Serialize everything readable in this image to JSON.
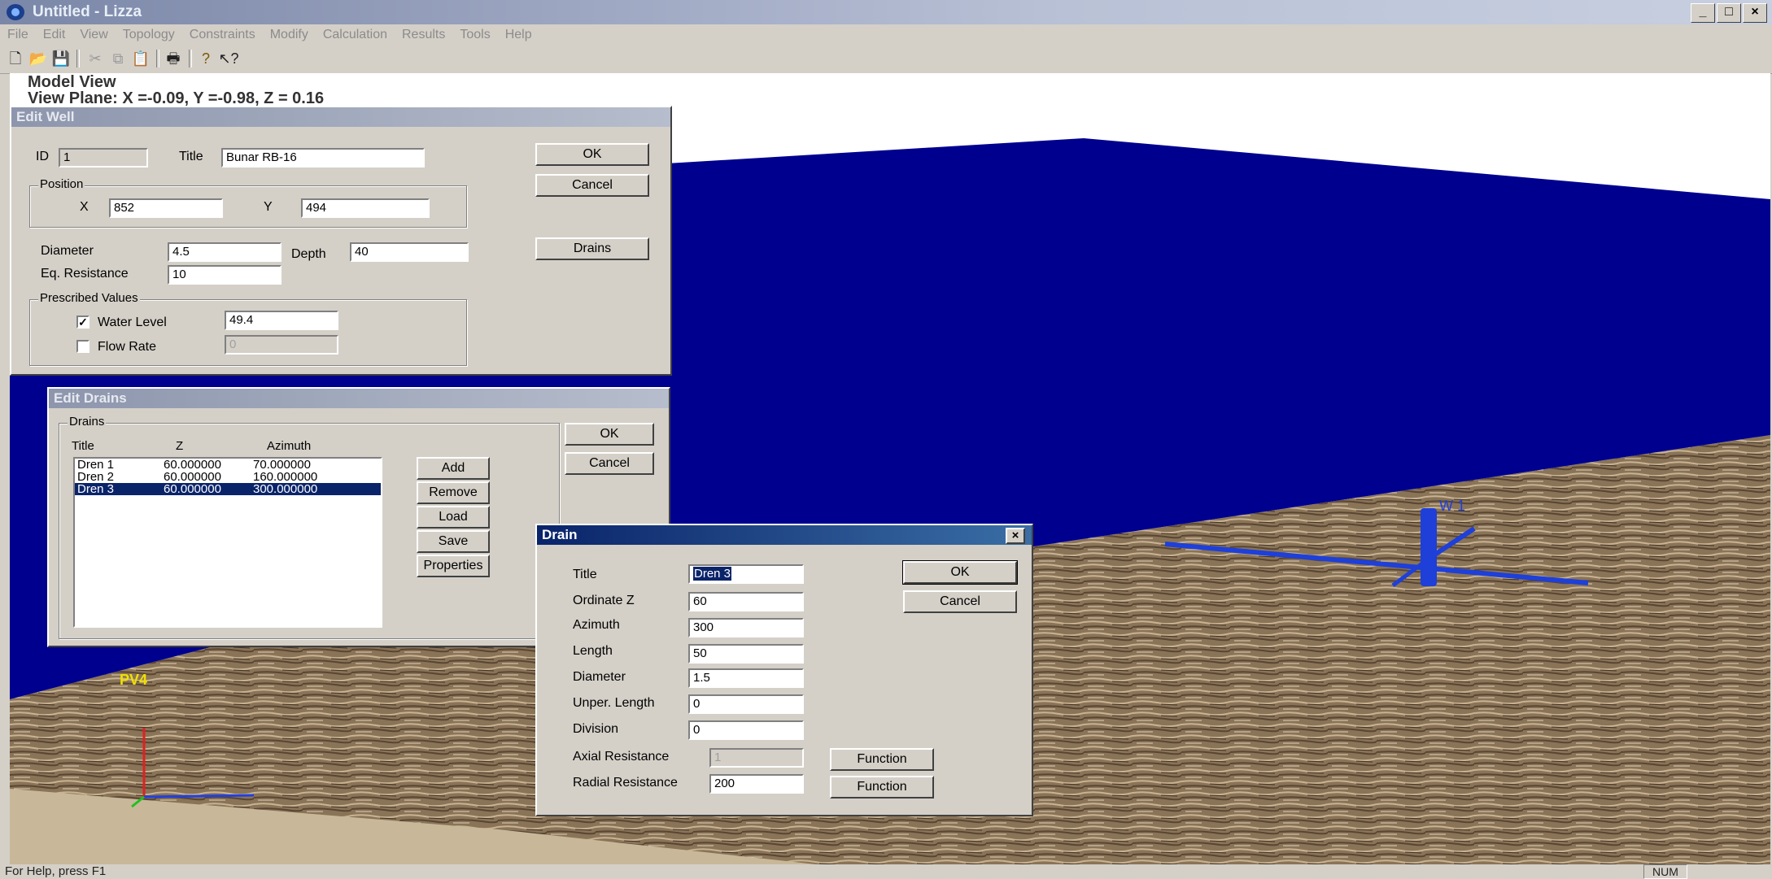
{
  "window": {
    "title": "Untitled - Lizza",
    "min": "_",
    "max": "□",
    "close": "×"
  },
  "menu": [
    "File",
    "Edit",
    "View",
    "Topology",
    "Constraints",
    "Modify",
    "Calculation",
    "Results",
    "Tools",
    "Help"
  ],
  "model_view": {
    "title": "Model View",
    "plane": "View Plane: X =-0.09,  Y =-0.98,  Z = 0.16",
    "well_label_w1": "W 1",
    "well_label_pv4": "PV4"
  },
  "edit_well": {
    "title": "Edit Well",
    "id_label": "ID",
    "id_value": "1",
    "title_label": "Title",
    "title_value": "Bunar RB-16",
    "position_label": "Position",
    "x_label": "X",
    "x_value": "852",
    "y_label": "Y",
    "y_value": "494",
    "diameter_label": "Diameter",
    "diameter_value": "4.5",
    "depth_label": "Depth",
    "depth_value": "40",
    "eq_res_label": "Eq. Resistance",
    "eq_res_value": "10",
    "prescribed_label": "Prescribed Values",
    "water_level_label": "Water Level",
    "water_level_value": "49.4",
    "water_level_checked": "✓",
    "flow_rate_label": "Flow Rate",
    "flow_rate_value": "0",
    "ok": "OK",
    "cancel": "Cancel",
    "drains": "Drains"
  },
  "edit_drains": {
    "title": "Edit Drains",
    "group_label": "Drains",
    "headers": [
      "Title",
      "Z",
      "Azimuth"
    ],
    "rows": [
      {
        "title": "Dren 1",
        "z": "60.000000",
        "azimuth": "70.000000"
      },
      {
        "title": "Dren 2",
        "z": "60.000000",
        "azimuth": "160.000000"
      },
      {
        "title": "Dren 3",
        "z": "60.000000",
        "azimuth": "300.000000"
      }
    ],
    "add": "Add",
    "remove": "Remove",
    "load": "Load",
    "save": "Save",
    "properties": "Properties",
    "ok": "OK",
    "cancel": "Cancel"
  },
  "drain": {
    "title": "Drain",
    "close": "×",
    "title_label": "Title",
    "title_value": "Dren 3",
    "ordinate_label": "Ordinate Z",
    "ordinate_value": "60",
    "azimuth_label": "Azimuth",
    "azimuth_value": "300",
    "length_label": "Length",
    "length_value": "50",
    "diameter_label": "Diameter",
    "diameter_value": "1.5",
    "unper_label": "Unper. Length",
    "unper_value": "0",
    "division_label": "Division",
    "division_value": "0",
    "axial_label": "Axial Resistance",
    "axial_value": "1",
    "radial_label": "Radial Resistance",
    "radial_value": "200",
    "function": "Function",
    "ok": "OK",
    "cancel": "Cancel"
  },
  "status": {
    "help": "For Help, press F1",
    "num": "NUM"
  },
  "colors": {
    "plane": "#00008f",
    "ground": "#8a7458",
    "well": "#1e3fd8"
  }
}
